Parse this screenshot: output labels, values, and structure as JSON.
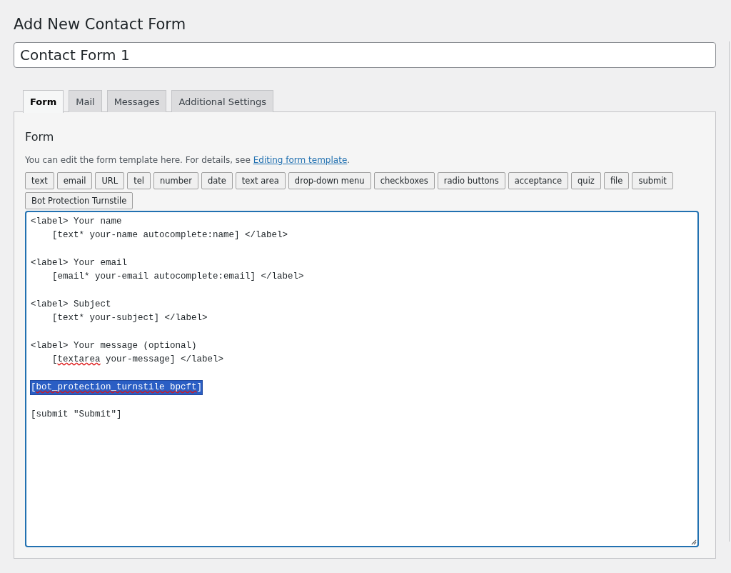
{
  "page_title": "Add New Contact Form",
  "title_field": {
    "value": "Contact Form 1"
  },
  "tabs": [
    {
      "label": "Form",
      "selected": true
    },
    {
      "label": "Mail",
      "selected": false
    },
    {
      "label": "Messages",
      "selected": false
    },
    {
      "label": "Additional Settings",
      "selected": false
    }
  ],
  "panel": {
    "heading": "Form",
    "description": "You can edit the form template here. For details, see ",
    "link": "Editing form template",
    "description_end": ".",
    "tag_buttons": [
      "text",
      "email",
      "URL",
      "tel",
      "number",
      "date",
      "text area",
      "drop-down menu",
      "checkboxes",
      "radio buttons",
      "acceptance",
      "quiz",
      "file",
      "submit",
      "Bot Protection Turnstile"
    ],
    "editor_lines": [
      {
        "kind": "code",
        "selected": false,
        "segments": [
          {
            "text": "<label> Your name",
            "kind": "plain"
          }
        ]
      },
      {
        "kind": "code",
        "selected": false,
        "segments": [
          {
            "text": "    [text* your-name autocomplete:name] </label>",
            "kind": "plain"
          }
        ]
      },
      {
        "kind": "blank",
        "selected": false
      },
      {
        "kind": "code",
        "selected": false,
        "segments": [
          {
            "text": "<label> Your email",
            "kind": "plain"
          }
        ]
      },
      {
        "kind": "code",
        "selected": false,
        "segments": [
          {
            "text": "    [email* your-email autocomplete:email] </label>",
            "kind": "plain"
          }
        ]
      },
      {
        "kind": "blank",
        "selected": false
      },
      {
        "kind": "code",
        "selected": false,
        "segments": [
          {
            "text": "<label> Subject",
            "kind": "plain"
          }
        ]
      },
      {
        "kind": "code",
        "selected": false,
        "segments": [
          {
            "text": "    [text* your-subject] </label>",
            "kind": "plain"
          }
        ]
      },
      {
        "kind": "blank",
        "selected": false
      },
      {
        "kind": "code",
        "selected": false,
        "segments": [
          {
            "text": "<label> Your message (optional)",
            "kind": "plain"
          }
        ]
      },
      {
        "kind": "code",
        "selected": false,
        "segments": [
          {
            "text": "    [",
            "kind": "plain"
          },
          {
            "text": "textarea",
            "kind": "misspelled"
          },
          {
            "text": " your-message] </label>",
            "kind": "plain"
          }
        ]
      },
      {
        "kind": "blank",
        "selected": false
      },
      {
        "kind": "code",
        "selected": true,
        "segments": [
          {
            "text": "[",
            "kind": "plain"
          },
          {
            "text": "bot_protection_turnstile bpcft",
            "kind": "misspelled"
          },
          {
            "text": "]",
            "kind": "plain"
          }
        ]
      },
      {
        "kind": "blank",
        "selected": false
      },
      {
        "kind": "code",
        "selected": false,
        "segments": [
          {
            "text": "[submit \"Submit\"]",
            "kind": "plain"
          }
        ]
      }
    ]
  }
}
